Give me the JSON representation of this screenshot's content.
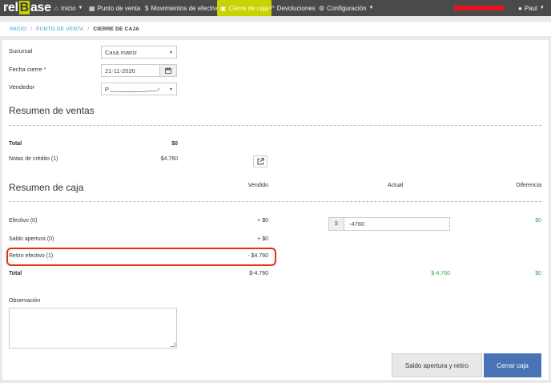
{
  "brand": {
    "pre": "rel",
    "mid": "B",
    "post": "ase"
  },
  "nav": {
    "inicio": "Inicio",
    "punto_venta": "Punto de venta",
    "movimientos": "Movimientos de efectivo",
    "cierre": "Cierre de caja",
    "devoluciones": "Devoluciones",
    "configuracion": "Configuración",
    "user": "Paul"
  },
  "breadcrumb": {
    "inicio": "INICIO",
    "punto_venta": "PUNTO DE VENTA",
    "current": "CIERRE DE CAJA"
  },
  "form": {
    "sucursal_label": "Sucursal",
    "sucursal_value": "Casa matriz",
    "fecha_label": "Fecha cierre",
    "fecha_required": "*",
    "fecha_value": "21-11-2020",
    "vendedor_label": "Vendedor",
    "vendedor_value": "P"
  },
  "resumen_ventas": {
    "title": "Resumen de ventas",
    "total_label": "Total",
    "total_value": "$0",
    "notas_label": "Notas de crédito (1)",
    "notas_value": "$4.760"
  },
  "resumen_caja": {
    "title": "Resumen de caja",
    "col_vendido": "Vendido",
    "col_actual": "Actual",
    "col_diferencia": "Diferencia",
    "rows": [
      {
        "label": "Efectivo (0)",
        "vendido": "+ $0",
        "actual_prefix": "$",
        "actual_value": "-4760",
        "diferencia": "$0"
      },
      {
        "label": "Saldo apertura (0)",
        "vendido": "+ $0"
      },
      {
        "label": "Retiro efectivo (1)",
        "vendido": "- $4.760"
      },
      {
        "label": "Total",
        "vendido": "$-4.760",
        "actual": "$-4.760",
        "diferencia": "$0"
      }
    ]
  },
  "observacion_label": "Observación",
  "buttons": {
    "saldo": "Saldo apertura y retiro",
    "cerrar": "Cerrar caja"
  },
  "colors": {
    "navbar": "#4a4a4a",
    "accent": "#c8d300",
    "primary": "#4a73b6",
    "link": "#2a9fd6",
    "positive": "#2fa84f",
    "highlight": "#e52e12"
  }
}
